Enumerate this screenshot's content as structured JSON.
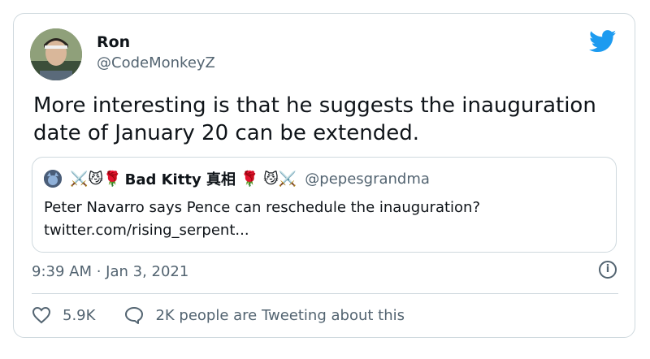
{
  "author": {
    "name": "Ron",
    "handle": "@CodeMonkeyZ"
  },
  "tweet": {
    "text": "More interesting is that he suggests the inauguration date of January 20 can be extended."
  },
  "quoted": {
    "prefix_emojis": "⚔️😼🌹",
    "name": "Bad Kitty 真相",
    "suffix_emojis": "🌹 😼⚔️",
    "handle": "@pepesgrandma",
    "text": "Peter Navarro says Pence can reschedule the inauguration? twitter.com/rising_serpent..."
  },
  "timestamp": "9:39 AM · Jan 3, 2021",
  "actions": {
    "likes": "5.9K",
    "conversation": "2K people are Tweeting about this"
  },
  "colors": {
    "brand": "#1d9bf0",
    "secondary_text": "#536471",
    "border": "#cfd9de"
  },
  "icons": [
    "twitter-bird-icon",
    "info-icon",
    "heart-icon",
    "speech-bubble-icon"
  ]
}
